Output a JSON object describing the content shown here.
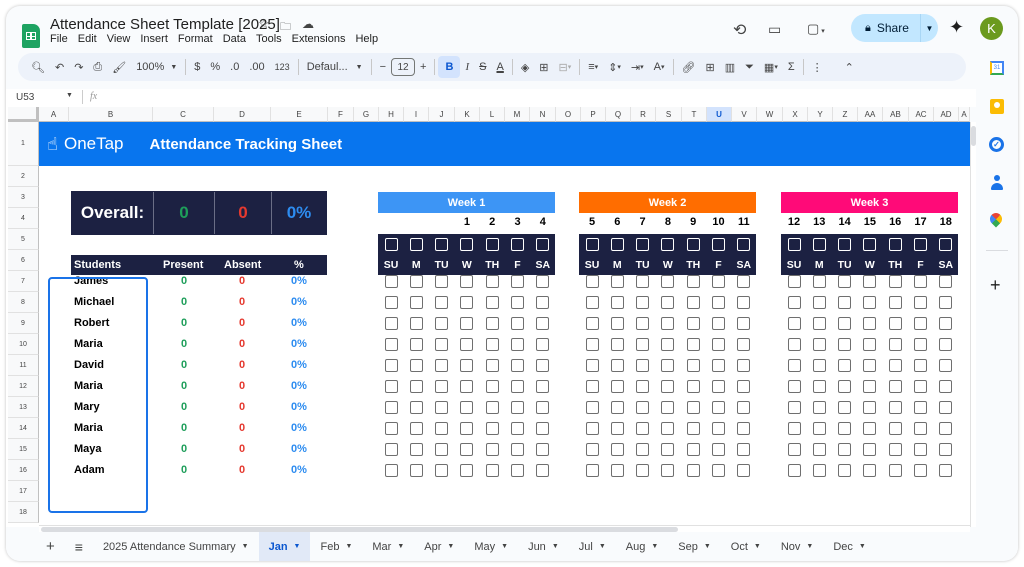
{
  "app": {
    "doc_title": "Attendance Sheet Template [2025]",
    "menu": [
      "File",
      "Edit",
      "View",
      "Insert",
      "Format",
      "Data",
      "Tools",
      "Extensions",
      "Help"
    ],
    "share_label": "Share",
    "avatar_letter": "K"
  },
  "toolbar": {
    "zoom": "100%",
    "currency": "$",
    "percent": "%",
    "dec_decrease": ".0",
    "dec_increase": ".00",
    "number_format": "123",
    "font": "Defaul...",
    "font_size": "12",
    "bold": "B",
    "italic": "I",
    "sum": "Σ"
  },
  "formula_bar": {
    "name_box": "U53",
    "fx": "fx",
    "value": ""
  },
  "columns": [
    "A",
    "B",
    "C",
    "D",
    "E",
    "F",
    "G",
    "H",
    "I",
    "J",
    "K",
    "L",
    "M",
    "N",
    "O",
    "P",
    "Q",
    "R",
    "S",
    "T",
    "U",
    "V",
    "W",
    "X",
    "Y",
    "Z",
    "AA",
    "AB",
    "AC",
    "AD",
    "A"
  ],
  "selected_column": "U",
  "rows": [
    "1",
    "2",
    "3",
    "4",
    "5",
    "6",
    "7",
    "8",
    "9",
    "10",
    "11",
    "12",
    "13",
    "14",
    "15",
    "16",
    "17",
    "18"
  ],
  "sheet": {
    "brand": "OneTap",
    "title": "Attendance Tracking Sheet",
    "overall": {
      "label": "Overall:",
      "present": "0",
      "absent": "0",
      "percent": "0%"
    },
    "table_headers": {
      "students": "Students",
      "present": "Present",
      "absent": "Absent",
      "percent": "%"
    },
    "students": [
      {
        "name": "James",
        "present": "0",
        "absent": "0",
        "percent": "0%"
      },
      {
        "name": "Michael",
        "present": "0",
        "absent": "0",
        "percent": "0%"
      },
      {
        "name": "Robert",
        "present": "0",
        "absent": "0",
        "percent": "0%"
      },
      {
        "name": "Maria",
        "present": "0",
        "absent": "0",
        "percent": "0%"
      },
      {
        "name": "David",
        "present": "0",
        "absent": "0",
        "percent": "0%"
      },
      {
        "name": "Maria",
        "present": "0",
        "absent": "0",
        "percent": "0%"
      },
      {
        "name": "Mary",
        "present": "0",
        "absent": "0",
        "percent": "0%"
      },
      {
        "name": "Maria",
        "present": "0",
        "absent": "0",
        "percent": "0%"
      },
      {
        "name": "Maya",
        "present": "0",
        "absent": "0",
        "percent": "0%"
      },
      {
        "name": "Adam",
        "present": "0",
        "absent": "0",
        "percent": "0%"
      }
    ],
    "weeks": [
      {
        "label": "Week 1",
        "color": "#3d95f5",
        "dates": [
          "",
          "",
          "",
          "1",
          "2",
          "3",
          "4"
        ]
      },
      {
        "label": "Week 2",
        "color": "#ff6d00",
        "dates": [
          "5",
          "6",
          "7",
          "8",
          "9",
          "10",
          "11"
        ]
      },
      {
        "label": "Week 3",
        "color": "#ff0a78",
        "dates": [
          "12",
          "13",
          "14",
          "15",
          "16",
          "17",
          "18"
        ]
      }
    ],
    "day_labels": [
      "SU",
      "M",
      "TU",
      "W",
      "TH",
      "F",
      "SA"
    ]
  },
  "sheet_tabs": [
    {
      "label": "2025 Attendance Summary",
      "active": false
    },
    {
      "label": "Jan",
      "active": true
    },
    {
      "label": "Feb",
      "active": false
    },
    {
      "label": "Mar",
      "active": false
    },
    {
      "label": "Apr",
      "active": false
    },
    {
      "label": "May",
      "active": false
    },
    {
      "label": "Jun",
      "active": false
    },
    {
      "label": "Jul",
      "active": false
    },
    {
      "label": "Aug",
      "active": false
    },
    {
      "label": "Sep",
      "active": false
    },
    {
      "label": "Oct",
      "active": false
    },
    {
      "label": "Nov",
      "active": false
    },
    {
      "label": "Dec",
      "active": false
    }
  ],
  "side_panel": [
    "calendar-icon",
    "keep-icon",
    "tasks-icon",
    "contacts-icon",
    "maps-icon",
    "add-icon"
  ]
}
